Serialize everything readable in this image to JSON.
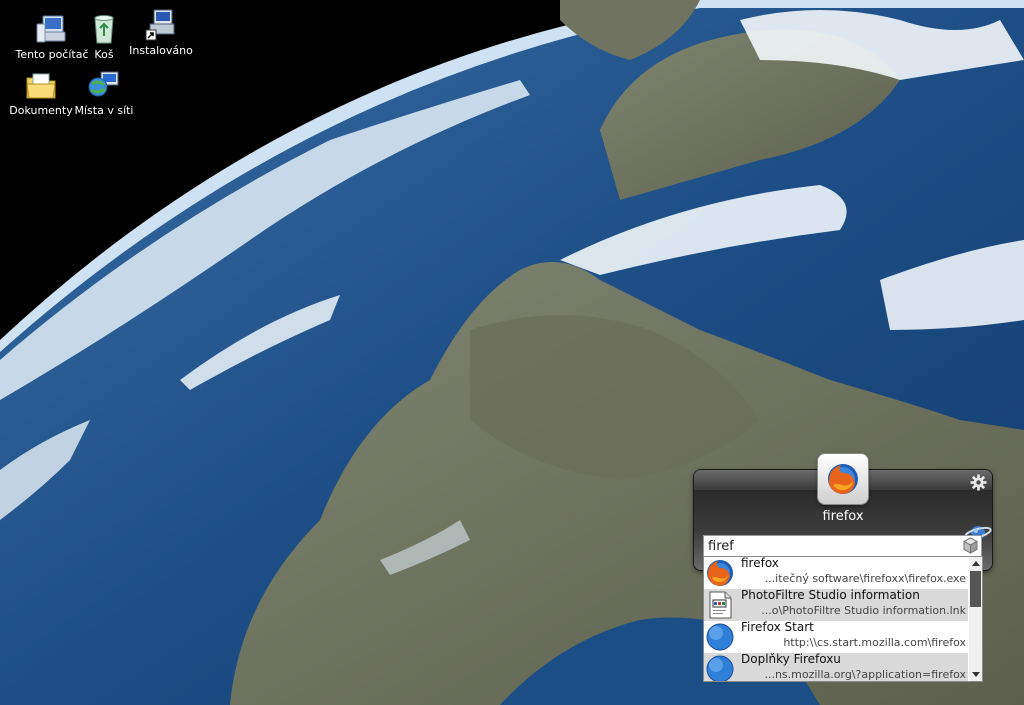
{
  "desktop": {
    "icons": [
      {
        "label": "Tento počítač",
        "icon": "my-computer-icon"
      },
      {
        "label": "Koš",
        "icon": "recycle-bin-icon"
      },
      {
        "label": "Instalováno",
        "icon": "installer-shortcut-icon"
      },
      {
        "label": "Dokumenty",
        "icon": "documents-folder-icon"
      },
      {
        "label": "Místa v síti",
        "icon": "network-places-icon"
      }
    ]
  },
  "launcher": {
    "selected_app": "firefox",
    "search": {
      "value": "firef",
      "placeholder": ""
    },
    "results": [
      {
        "title": "firefox",
        "path": "...itečný software\\firefoxx\\firefox.exe",
        "icon": "firefox-icon"
      },
      {
        "title": "PhotoFiltre Studio information",
        "path": "...o\\PhotoFiltre Studio information.lnk",
        "icon": "document-icon"
      },
      {
        "title": "Firefox Start",
        "path": "http:\\\\cs.start.mozilla.com\\firefox",
        "icon": "globe-icon"
      },
      {
        "title": "Doplňky Firefoxu",
        "path": "...ns.mozilla.org\\?application=firefox",
        "icon": "globe-icon"
      }
    ]
  },
  "colors": {
    "highlight_row": "#d9d9d9",
    "launcher_dark": "#2a2a2a",
    "text_white": "#ffffff"
  }
}
